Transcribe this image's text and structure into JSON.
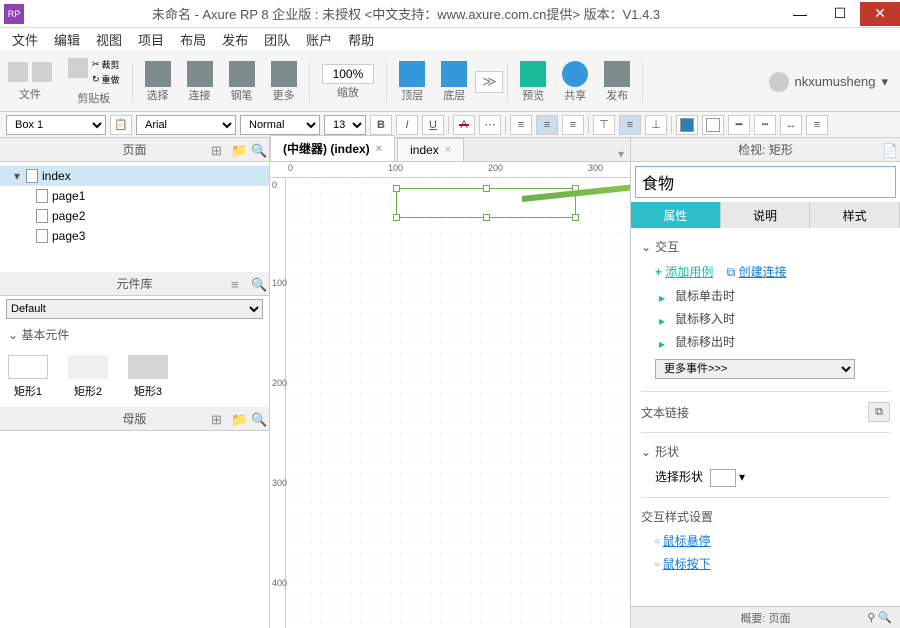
{
  "titlebar": {
    "logo": "RP",
    "title": "未命名 - Axure RP 8 企业版 : 未授权    <中文支持：www.axure.com.cn提供> 版本：V1.4.3"
  },
  "menu": [
    "文件",
    "编辑",
    "视图",
    "项目",
    "布局",
    "发布",
    "团队",
    "账户",
    "帮助"
  ],
  "toolbar": {
    "file": "文件",
    "clipboard": "剪贴板",
    "cut": "裁剪",
    "redo": "重做",
    "select": "选择",
    "connect": "连接",
    "pen": "钢笔",
    "more": "更多",
    "zoom": "100%",
    "zoom_lbl": "缩放",
    "top": "顶层",
    "bottom": "底层",
    "preview": "预览",
    "share": "共享",
    "publish": "发布",
    "user": "nkxumusheng"
  },
  "fmt": {
    "shape": "Box 1",
    "font": "Arial",
    "weight": "Normal",
    "size": "13"
  },
  "left": {
    "pages_title": "页面",
    "tree_root": "index",
    "tree_children": [
      "page1",
      "page2",
      "page3"
    ],
    "lib_title": "元件库",
    "lib_select": "Default",
    "lib_cat": "基本元件",
    "lib_items": [
      "矩形1",
      "矩形2",
      "矩形3"
    ],
    "masters_title": "母版"
  },
  "center": {
    "tab1": "(中继器) (index)",
    "tab2": "index",
    "ruler_h": [
      "0",
      "100",
      "200",
      "300"
    ],
    "ruler_v": [
      "0",
      "100",
      "200",
      "300",
      "400"
    ]
  },
  "right": {
    "inspect_title": "检视: 矩形",
    "name_value": "食物",
    "tabs": [
      "属性",
      "说明",
      "样式"
    ],
    "sect_interact": "交互",
    "add_case": "添加用例",
    "create_link": "创建连接",
    "events": [
      "鼠标单击时",
      "鼠标移入时",
      "鼠标移出时"
    ],
    "more_events": "更多事件>>>",
    "text_link": "文本链接",
    "sect_shape": "形状",
    "select_shape": "选择形状",
    "interact_style": "交互样式设置",
    "hover": "鼠标悬停",
    "press": "鼠标按下",
    "outline": "概要: 页面"
  }
}
